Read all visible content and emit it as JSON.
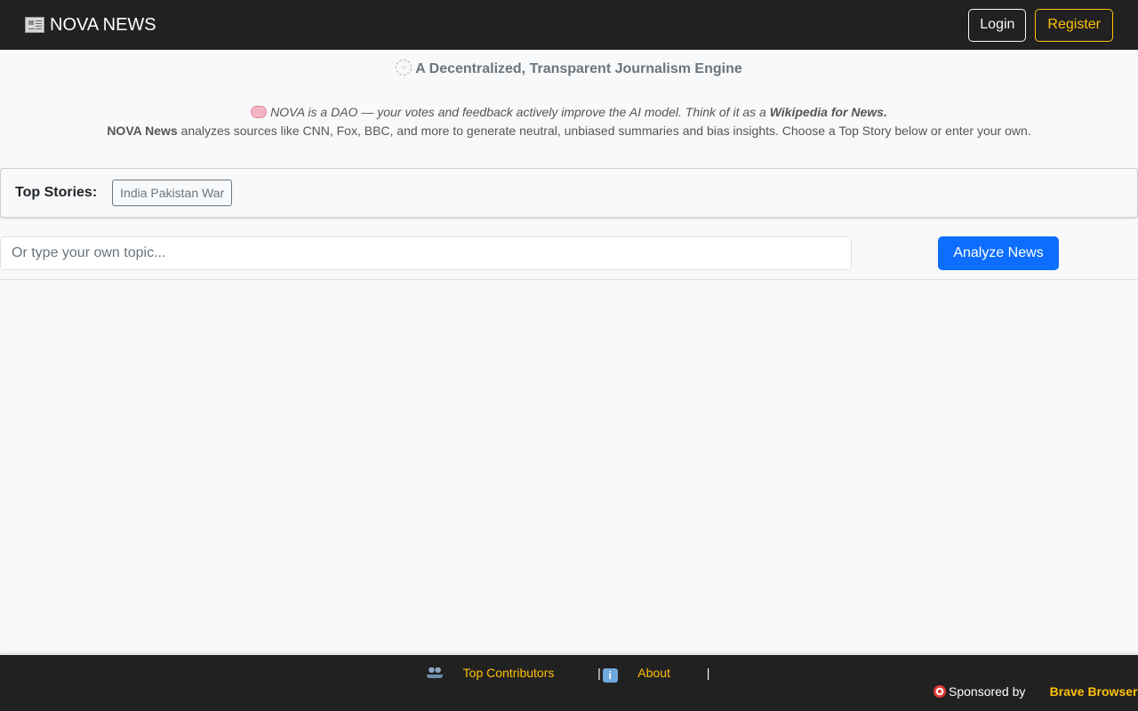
{
  "navbar": {
    "brand": "NOVA NEWS",
    "login_label": "Login",
    "register_label": "Register"
  },
  "tagline": "A Decentralized, Transparent Journalism Engine",
  "intro": {
    "dao_text": "NOVA is a DAO — your votes and feedback actively improve the AI model. Think of it as a ",
    "dao_bold": "Wikipedia for News.",
    "analysis_bold": "NOVA News",
    "analysis_text": " analyzes sources like CNN, Fox, BBC, and more to generate neutral, unbiased summaries and bias insights. Choose a Top Story below or enter your own."
  },
  "top_stories": {
    "label": "Top Stories:",
    "items": [
      "India Pakistan War"
    ]
  },
  "search": {
    "placeholder": "Or type your own topic...",
    "value": "",
    "button_label": "Analyze News"
  },
  "footer": {
    "contributors_label": "Top Contributors",
    "about_label": "About",
    "separator": "|",
    "sponsored_by": "Sponsored by",
    "sponsor_name": "Brave Browser"
  },
  "colors": {
    "navbar_bg": "#212121",
    "accent_warning": "#ffc107",
    "primary": "#0d6efd",
    "muted": "#6c757d"
  },
  "icons": {
    "brand": "newspaper-icon",
    "tagline": "web-icon",
    "intro": "brain-icon",
    "contributors": "people-icon",
    "about": "info-icon",
    "sponsor": "target-icon"
  }
}
